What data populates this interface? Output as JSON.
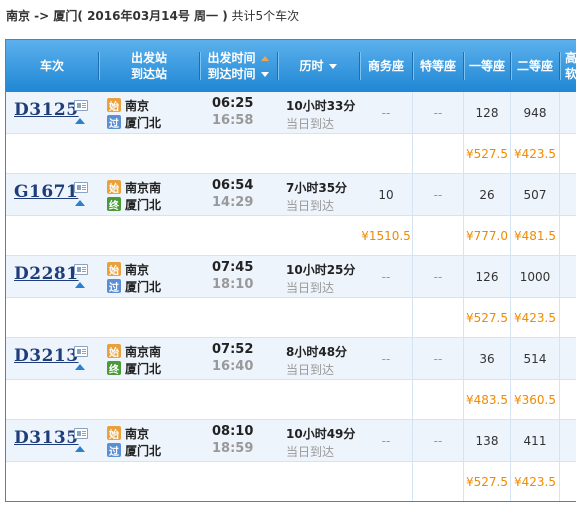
{
  "summary": {
    "route": "南京 -> 厦门",
    "date": "( 2016年03月14号  周一 )",
    "count_text": "共计5个车次"
  },
  "header": {
    "train_no": "车次",
    "station_top": "出发站",
    "station_bottom": "到达站",
    "time_top": "出发时间",
    "time_bottom": "到达时间",
    "duration": "历时",
    "business": "商务座",
    "premium": "特等座",
    "first": "一等座",
    "second": "二等座",
    "cut_top": "高",
    "cut_bottom": "软"
  },
  "icons": {
    "card": "ticket-info-icon",
    "expand": "expand-up-icon",
    "sort_down": "sort-down-icon",
    "sort_up": "sort-up-icon"
  },
  "colors": {
    "header": "#1f87d4",
    "row_bg": "#eef4fb",
    "price": "#f08a00",
    "train_code": "#1f3d7a"
  },
  "trains": [
    {
      "code": "D3125",
      "from_badge": "始",
      "from_badge_type": "start",
      "from": "南京",
      "to_badge": "过",
      "to_badge_type": "pass",
      "to": "厦门北",
      "dep": "06:25",
      "arr": "16:58",
      "duration": "10小时33分",
      "arrive_day": "当日到达",
      "business": "--",
      "premium": "--",
      "first": "128",
      "second": "948",
      "price_business": "",
      "price_first": "¥527.5",
      "price_second": "¥423.5"
    },
    {
      "code": "G1671",
      "from_badge": "始",
      "from_badge_type": "start",
      "from": "南京南",
      "to_badge": "终",
      "to_badge_type": "end",
      "to": "厦门北",
      "dep": "06:54",
      "arr": "14:29",
      "duration": "7小时35分",
      "arrive_day": "当日到达",
      "business": "10",
      "premium": "--",
      "first": "26",
      "second": "507",
      "price_business": "¥1510.5",
      "price_first": "¥777.0",
      "price_second": "¥481.5"
    },
    {
      "code": "D2281",
      "from_badge": "始",
      "from_badge_type": "start",
      "from": "南京",
      "to_badge": "过",
      "to_badge_type": "pass",
      "to": "厦门北",
      "dep": "07:45",
      "arr": "18:10",
      "duration": "10小时25分",
      "arrive_day": "当日到达",
      "business": "--",
      "premium": "--",
      "first": "126",
      "second": "1000",
      "price_business": "",
      "price_first": "¥527.5",
      "price_second": "¥423.5"
    },
    {
      "code": "D3213",
      "from_badge": "始",
      "from_badge_type": "start",
      "from": "南京南",
      "to_badge": "终",
      "to_badge_type": "end",
      "to": "厦门北",
      "dep": "07:52",
      "arr": "16:40",
      "duration": "8小时48分",
      "arrive_day": "当日到达",
      "business": "--",
      "premium": "--",
      "first": "36",
      "second": "514",
      "price_business": "",
      "price_first": "¥483.5",
      "price_second": "¥360.5"
    },
    {
      "code": "D3135",
      "from_badge": "始",
      "from_badge_type": "start",
      "from": "南京",
      "to_badge": "过",
      "to_badge_type": "pass",
      "to": "厦门北",
      "dep": "08:10",
      "arr": "18:59",
      "duration": "10小时49分",
      "arrive_day": "当日到达",
      "business": "--",
      "premium": "--",
      "first": "138",
      "second": "411",
      "price_business": "",
      "price_first": "¥527.5",
      "price_second": "¥423.5"
    }
  ]
}
